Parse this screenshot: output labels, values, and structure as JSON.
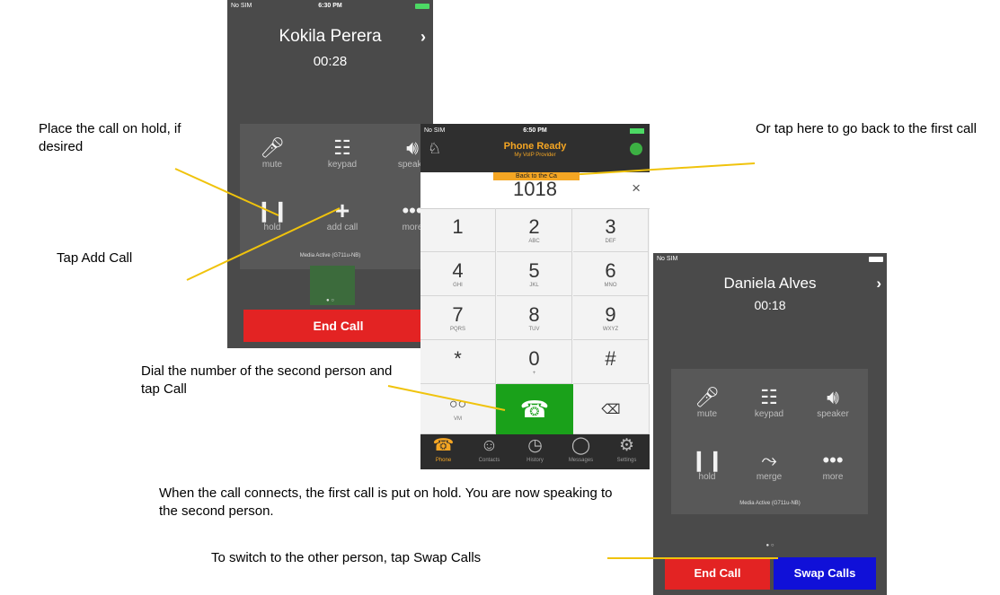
{
  "annotations": {
    "hold": "Place the call on hold, if desired",
    "add_call": "Tap Add Call",
    "back_to_first": "Or tap here to go back to the first call",
    "dial": "Dial the number of the second person and tap Call",
    "connects": "When the call connects, the first call is put on hold. You are now speaking to the second person.",
    "swap": "To switch to the other person, tap Swap Calls"
  },
  "phone1": {
    "status": {
      "carrier": "No SIM",
      "time": "6:30 PM"
    },
    "caller": "Kokila Perera",
    "timer": "00:28",
    "controls": [
      {
        "icon": "microphone-icon",
        "label": "mute"
      },
      {
        "icon": "keypad-icon",
        "label": "keypad"
      },
      {
        "icon": "speaker-icon",
        "label": "speake"
      },
      {
        "icon": "pause-icon",
        "label": "hold"
      },
      {
        "icon": "plus-icon",
        "label": "add call"
      },
      {
        "icon": "more-icon",
        "label": "more"
      }
    ],
    "media": "Media Active (G711u-NB)",
    "end_call": "End Call"
  },
  "phone2": {
    "status": {
      "carrier": "No SIM",
      "time": "6:50 PM"
    },
    "title": "Phone Ready",
    "subtitle": "My VoIP Provider",
    "back_banner": "Back to the Ca",
    "number": "1018",
    "keys": [
      {
        "digit": "1",
        "letters": ""
      },
      {
        "digit": "2",
        "letters": "ABC"
      },
      {
        "digit": "3",
        "letters": "DEF"
      },
      {
        "digit": "4",
        "letters": "GHI"
      },
      {
        "digit": "5",
        "letters": "JKL"
      },
      {
        "digit": "6",
        "letters": "MNO"
      },
      {
        "digit": "7",
        "letters": "PQRS"
      },
      {
        "digit": "8",
        "letters": "TUV"
      },
      {
        "digit": "9",
        "letters": "WXYZ"
      },
      {
        "digit": "*",
        "letters": ""
      },
      {
        "digit": "0",
        "letters": "+"
      },
      {
        "digit": "#",
        "letters": ""
      }
    ],
    "voicemail_label": "VM",
    "tabs": [
      {
        "label": "Phone",
        "icon": "phone-icon"
      },
      {
        "label": "Contacts",
        "icon": "contacts-icon"
      },
      {
        "label": "History",
        "icon": "history-icon"
      },
      {
        "label": "Messages",
        "icon": "messages-icon"
      },
      {
        "label": "Settings",
        "icon": "settings-icon"
      }
    ],
    "colors": {
      "accent": "#f5a623",
      "call_green": "#1aa11a"
    }
  },
  "phone3": {
    "status": {
      "carrier": "No SIM"
    },
    "caller": "Daniela Alves",
    "timer": "00:18",
    "controls": [
      {
        "icon": "microphone-icon",
        "label": "mute"
      },
      {
        "icon": "keypad-icon",
        "label": "keypad"
      },
      {
        "icon": "speaker-icon",
        "label": "speaker"
      },
      {
        "icon": "pause-icon",
        "label": "hold"
      },
      {
        "icon": "merge-icon",
        "label": "merge"
      },
      {
        "icon": "more-icon",
        "label": "more"
      }
    ],
    "media": "Media Active (G711u-NB)",
    "end_call": "End Call",
    "swap_calls": "Swap Calls"
  }
}
